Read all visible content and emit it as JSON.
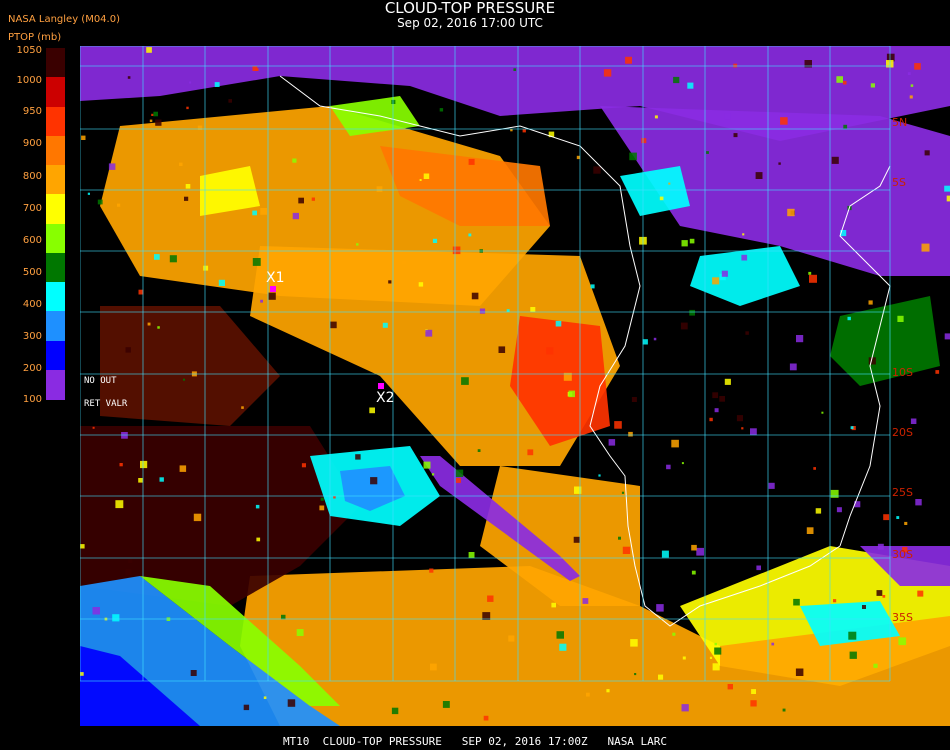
{
  "header": {
    "title": "CLOUD-TOP PRESSURE",
    "subtitle": "Sep 02, 2016 17:00 UTC",
    "producer": "NASA Langley (M04.0)",
    "unit": "PTOP (mb)"
  },
  "legend": {
    "ticks": [
      "1050",
      "1000",
      "950",
      "900",
      "800",
      "700",
      "600",
      "500",
      "400",
      "300",
      "200",
      "100"
    ],
    "colors": [
      "#3a0000",
      "#cc0000",
      "#ff3300",
      "#ff7700",
      "#ffa500",
      "#ffff00",
      "#88ff00",
      "#007700",
      "#00ffff",
      "#1e90ff",
      "#0000ff",
      "#8a2be2"
    ],
    "no_out_label": "NO   OUT",
    "ret_valr_label": "RET  VALR"
  },
  "map": {
    "lat_labels": [
      "5N",
      "5S",
      "10S",
      "20S",
      "25S",
      "30S",
      "35S"
    ],
    "markers": [
      {
        "label": "X1"
      },
      {
        "label": "X2"
      }
    ],
    "grid_color": "#40e0ff",
    "coast_color": "#ffffff"
  },
  "footer": {
    "text": "MT10  CLOUD-TOP PRESSURE   SEP 02, 2016 17:00Z   NASA LARC"
  }
}
